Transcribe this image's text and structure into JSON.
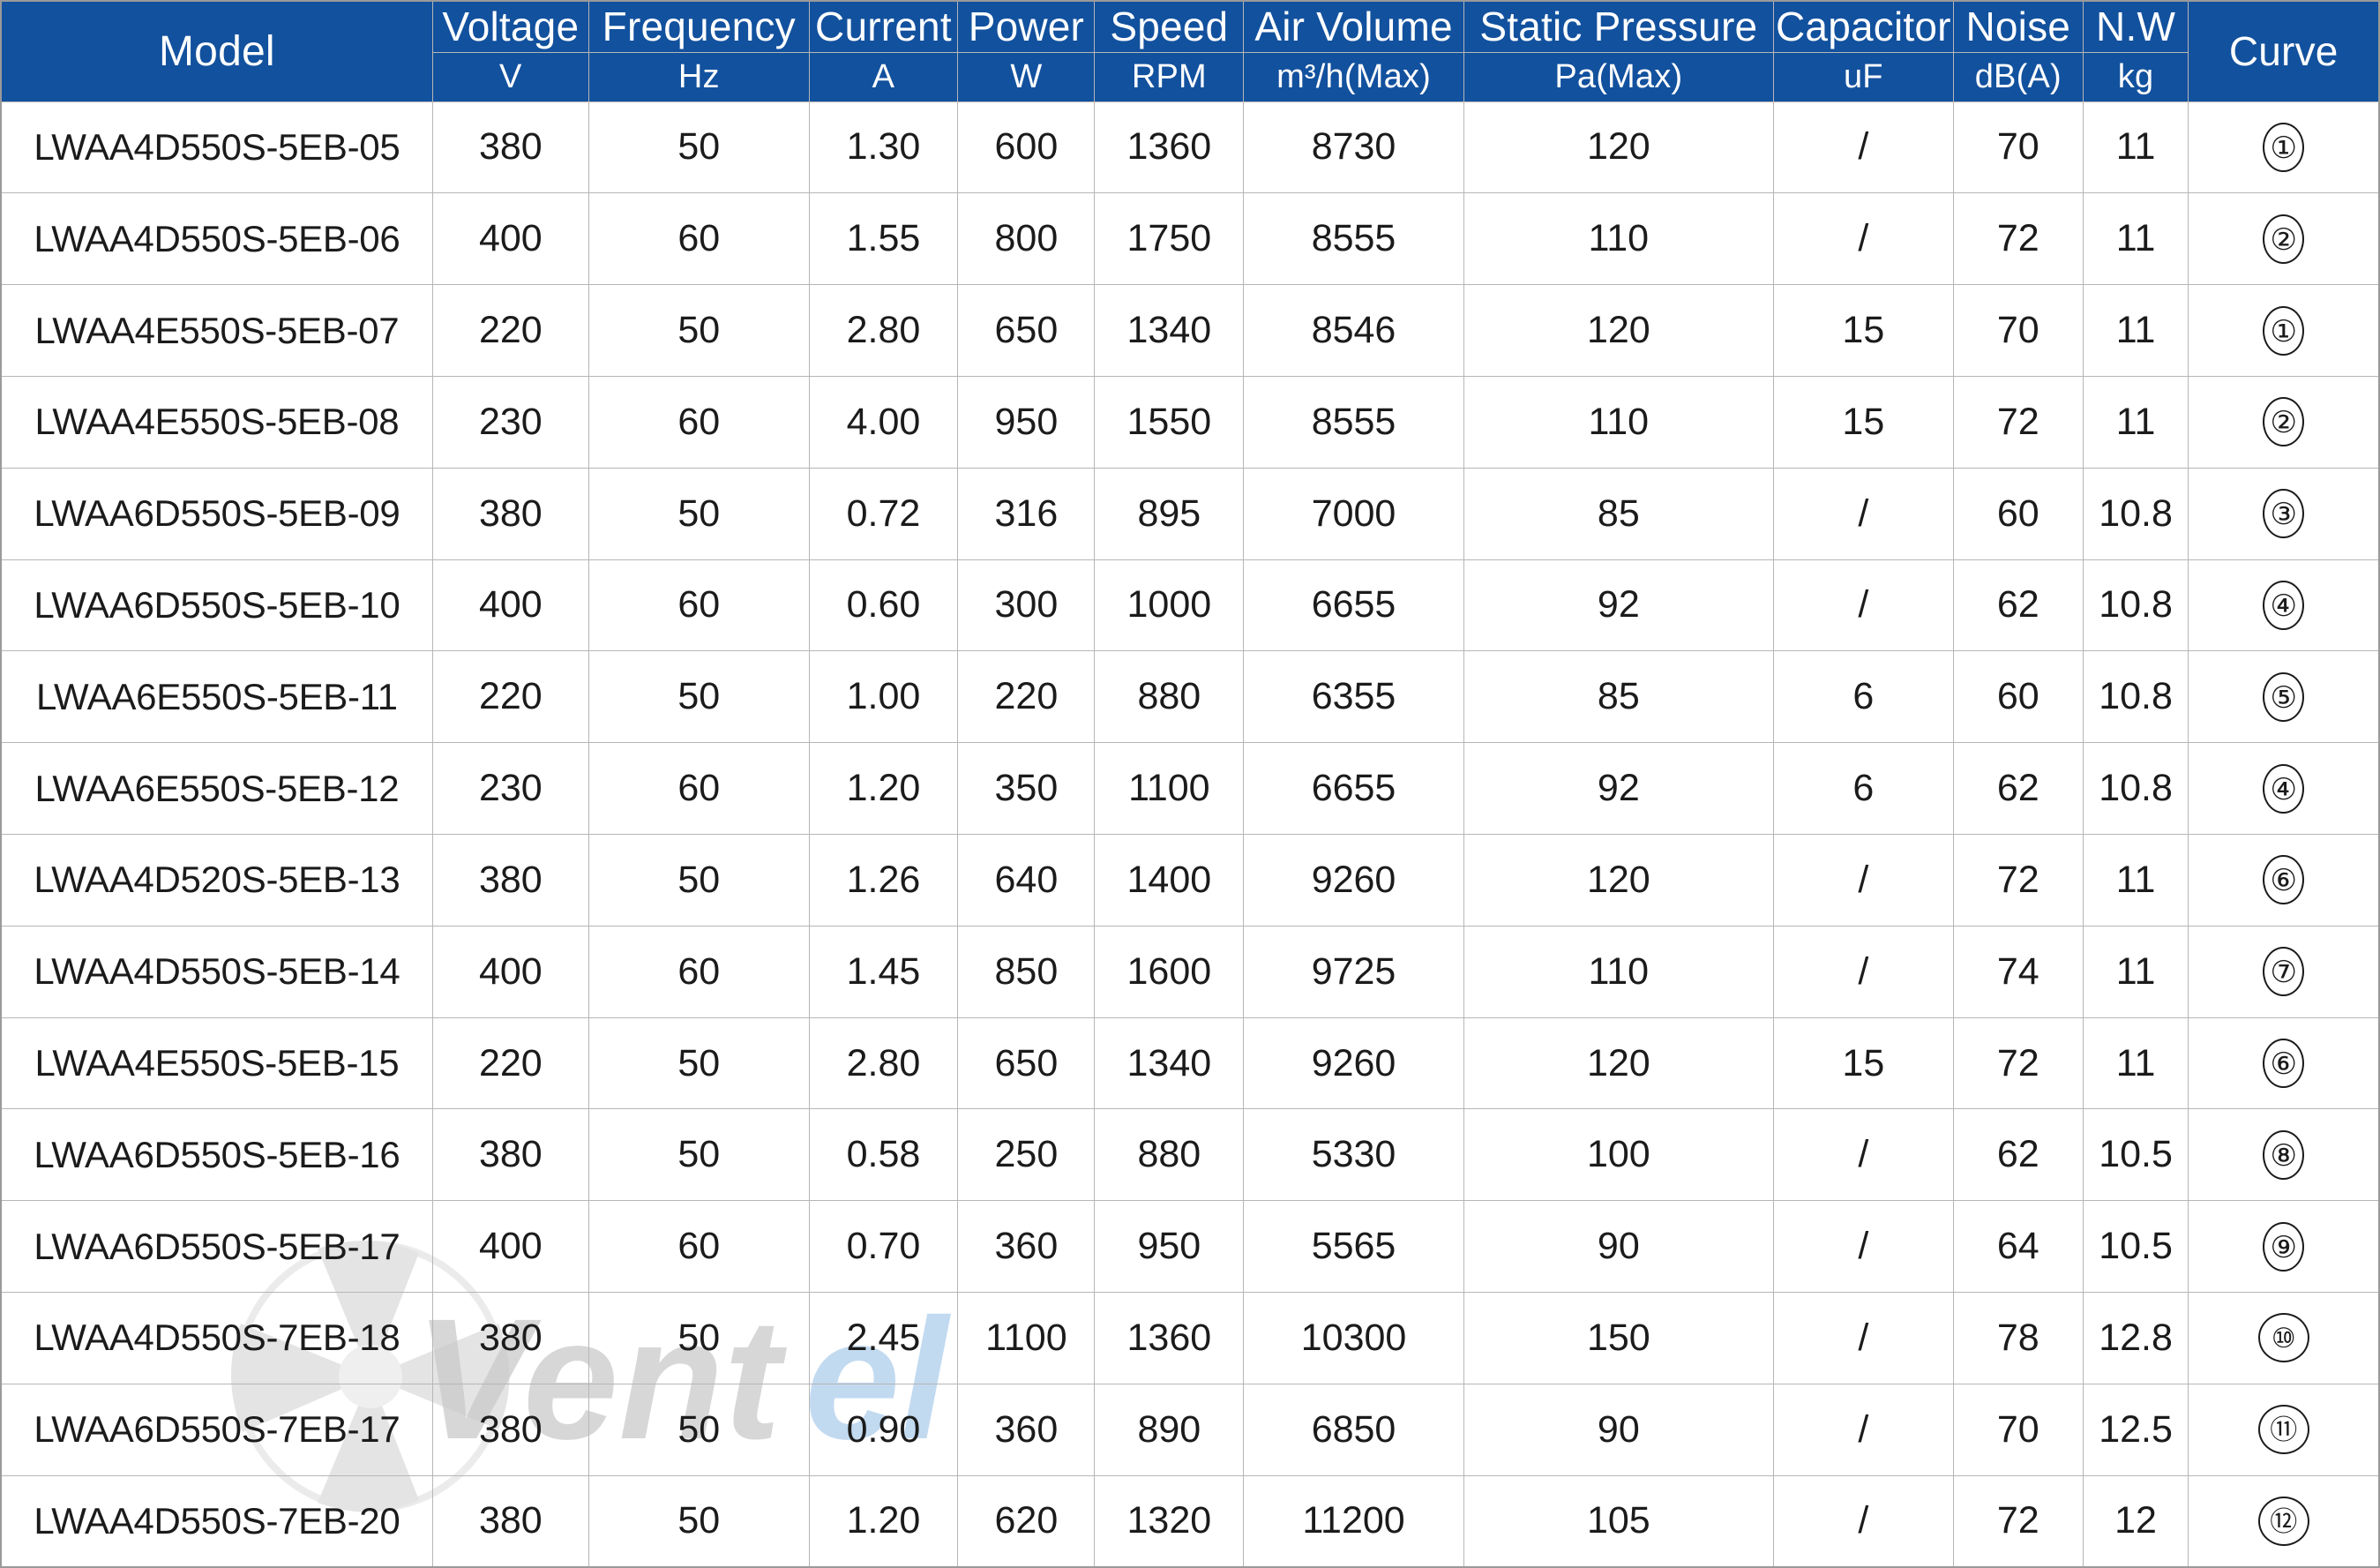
{
  "table": {
    "columns": [
      {
        "key": "model",
        "label": "Model",
        "unit": ""
      },
      {
        "key": "voltage",
        "label": "Voltage",
        "unit": "V"
      },
      {
        "key": "freq",
        "label": "Frequency",
        "unit": "Hz"
      },
      {
        "key": "current",
        "label": "Current",
        "unit": "A"
      },
      {
        "key": "power",
        "label": "Power",
        "unit": "W"
      },
      {
        "key": "speed",
        "label": "Speed",
        "unit": "RPM"
      },
      {
        "key": "air",
        "label": "Air Volume",
        "unit": "m³/h(Max)"
      },
      {
        "key": "static",
        "label": "Static Pressure",
        "unit": "Pa(Max)"
      },
      {
        "key": "cap",
        "label": "Capacitor",
        "unit": "uF"
      },
      {
        "key": "noise",
        "label": "Noise",
        "unit": "dB(A)"
      },
      {
        "key": "nw",
        "label": "N.W",
        "unit": "kg"
      },
      {
        "key": "curve",
        "label": "Curve",
        "unit": ""
      }
    ],
    "rows": [
      {
        "model": "LWAA4D550S-5EB-05",
        "voltage": "380",
        "freq": "50",
        "current": "1.30",
        "power": "600",
        "speed": "1360",
        "air": "8730",
        "static": "120",
        "cap": "/",
        "noise": "70",
        "nw": "11",
        "curve": "1"
      },
      {
        "model": "LWAA4D550S-5EB-06",
        "voltage": "400",
        "freq": "60",
        "current": "1.55",
        "power": "800",
        "speed": "1750",
        "air": "8555",
        "static": "110",
        "cap": "/",
        "noise": "72",
        "nw": "11",
        "curve": "2"
      },
      {
        "model": "LWAA4E550S-5EB-07",
        "voltage": "220",
        "freq": "50",
        "current": "2.80",
        "power": "650",
        "speed": "1340",
        "air": "8546",
        "static": "120",
        "cap": "15",
        "noise": "70",
        "nw": "11",
        "curve": "1"
      },
      {
        "model": "LWAA4E550S-5EB-08",
        "voltage": "230",
        "freq": "60",
        "current": "4.00",
        "power": "950",
        "speed": "1550",
        "air": "8555",
        "static": "110",
        "cap": "15",
        "noise": "72",
        "nw": "11",
        "curve": "2"
      },
      {
        "model": "LWAA6D550S-5EB-09",
        "voltage": "380",
        "freq": "50",
        "current": "0.72",
        "power": "316",
        "speed": "895",
        "air": "7000",
        "static": "85",
        "cap": "/",
        "noise": "60",
        "nw": "10.8",
        "curve": "3"
      },
      {
        "model": "LWAA6D550S-5EB-10",
        "voltage": "400",
        "freq": "60",
        "current": "0.60",
        "power": "300",
        "speed": "1000",
        "air": "6655",
        "static": "92",
        "cap": "/",
        "noise": "62",
        "nw": "10.8",
        "curve": "4"
      },
      {
        "model": "LWAA6E550S-5EB-11",
        "voltage": "220",
        "freq": "50",
        "current": "1.00",
        "power": "220",
        "speed": "880",
        "air": "6355",
        "static": "85",
        "cap": "6",
        "noise": "60",
        "nw": "10.8",
        "curve": "5"
      },
      {
        "model": "LWAA6E550S-5EB-12",
        "voltage": "230",
        "freq": "60",
        "current": "1.20",
        "power": "350",
        "speed": "1100",
        "air": "6655",
        "static": "92",
        "cap": "6",
        "noise": "62",
        "nw": "10.8",
        "curve": "4"
      },
      {
        "model": "LWAA4D520S-5EB-13",
        "voltage": "380",
        "freq": "50",
        "current": "1.26",
        "power": "640",
        "speed": "1400",
        "air": "9260",
        "static": "120",
        "cap": "/",
        "noise": "72",
        "nw": "11",
        "curve": "6"
      },
      {
        "model": "LWAA4D550S-5EB-14",
        "voltage": "400",
        "freq": "60",
        "current": "1.45",
        "power": "850",
        "speed": "1600",
        "air": "9725",
        "static": "110",
        "cap": "/",
        "noise": "74",
        "nw": "11",
        "curve": "7"
      },
      {
        "model": "LWAA4E550S-5EB-15",
        "voltage": "220",
        "freq": "50",
        "current": "2.80",
        "power": "650",
        "speed": "1340",
        "air": "9260",
        "static": "120",
        "cap": "15",
        "noise": "72",
        "nw": "11",
        "curve": "6"
      },
      {
        "model": "LWAA6D550S-5EB-16",
        "voltage": "380",
        "freq": "50",
        "current": "0.58",
        "power": "250",
        "speed": "880",
        "air": "5330",
        "static": "100",
        "cap": "/",
        "noise": "62",
        "nw": "10.5",
        "curve": "8"
      },
      {
        "model": "LWAA6D550S-5EB-17",
        "voltage": "400",
        "freq": "60",
        "current": "0.70",
        "power": "360",
        "speed": "950",
        "air": "5565",
        "static": "90",
        "cap": "/",
        "noise": "64",
        "nw": "10.5",
        "curve": "9"
      },
      {
        "model": "LWAA4D550S-7EB-18",
        "voltage": "380",
        "freq": "50",
        "current": "2.45",
        "power": "1100",
        "speed": "1360",
        "air": "10300",
        "static": "150",
        "cap": "/",
        "noise": "78",
        "nw": "12.8",
        "curve": "10"
      },
      {
        "model": "LWAA6D550S-7EB-17",
        "voltage": "380",
        "freq": "50",
        "current": "0.90",
        "power": "360",
        "speed": "890",
        "air": "6850",
        "static": "90",
        "cap": "/",
        "noise": "70",
        "nw": "12.5",
        "curve": "11"
      },
      {
        "model": "LWAA4D550S-7EB-20",
        "voltage": "380",
        "freq": "50",
        "current": "1.20",
        "power": "620",
        "speed": "1320",
        "air": "11200",
        "static": "105",
        "cap": "/",
        "noise": "72",
        "nw": "12",
        "curve": "12"
      }
    ]
  },
  "watermark": {
    "text_dark": "Vent",
    "text_light": "el",
    "color_dark": "#c9c9c9",
    "color_light": "#b8d4ee"
  },
  "theme": {
    "header_bg": "#12519e",
    "header_text": "#ffffff",
    "body_text": "#1b1b1b",
    "grid_line": "#b6b6b6"
  }
}
